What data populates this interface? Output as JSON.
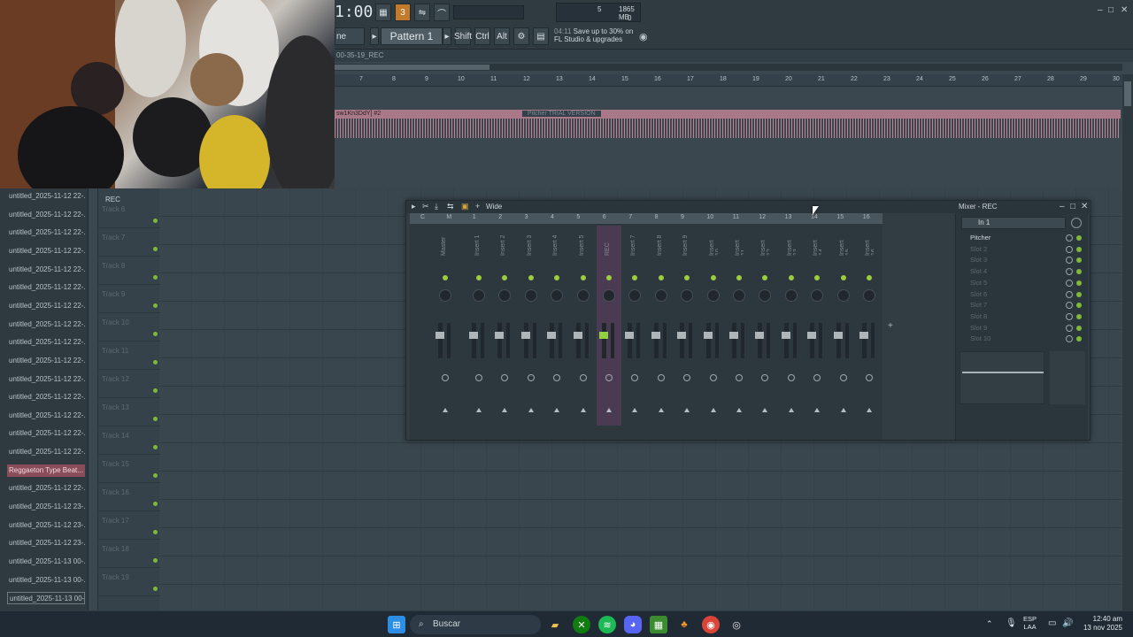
{
  "toolbar": {
    "clock": "1:00",
    "pattern": "Pattern 1",
    "shift": "Shift",
    "ctrl": "Ctrl",
    "alt": "Alt",
    "mode_label": "ne",
    "cpu_value": "5",
    "mem_value": "1865 MB",
    "mem_sub": "0",
    "promo_time": "04:11",
    "promo_text": "Save up to 30% on FL Studio & upgrades"
  },
  "playlist": {
    "title": "00-35-19_REC",
    "ruler": [
      "7",
      "8",
      "9",
      "10",
      "11",
      "12",
      "13",
      "14",
      "15",
      "16",
      "17",
      "18",
      "19",
      "20",
      "21",
      "22",
      "23",
      "24",
      "25",
      "26",
      "27",
      "28",
      "29",
      "30"
    ],
    "clip_label": "sw1Kn3DdY] #2",
    "pitcher_label": "Pitcher TRIAL VERSION",
    "rec_track_label": "REC"
  },
  "browser": {
    "items": [
      {
        "label": "untitled_2025-11-12 22-..."
      },
      {
        "label": "untitled_2025-11-12 22-..."
      },
      {
        "label": "untitled_2025-11-12 22-..."
      },
      {
        "label": "untitled_2025-11-12 22-..."
      },
      {
        "label": "untitled_2025-11-12 22-..."
      },
      {
        "label": "untitled_2025-11-12 22-..."
      },
      {
        "label": "untitled_2025-11-12 22-..."
      },
      {
        "label": "untitled_2025-11-12 22-..."
      },
      {
        "label": "untitled_2025-11-12 22-..."
      },
      {
        "label": "untitled_2025-11-12 22-..."
      },
      {
        "label": "untitled_2025-11-12 22-..."
      },
      {
        "label": "untitled_2025-11-12 22-..."
      },
      {
        "label": "untitled_2025-11-12 22-..."
      },
      {
        "label": "untitled_2025-11-12 22-..."
      },
      {
        "label": "untitled_2025-11-12 22-..."
      },
      {
        "label": "Reggaeton Type Beat..."
      },
      {
        "label": "untitled_2025-11-12 22-..."
      },
      {
        "label": "untitled_2025-11-12 23-..."
      },
      {
        "label": "untitled_2025-11-12 23-..."
      },
      {
        "label": "untitled_2025-11-12 23-..."
      },
      {
        "label": "untitled_2025-11-13 00-..."
      },
      {
        "label": "untitled_2025-11-13 00-..."
      },
      {
        "label": "untitled_2025-11-13 00-..."
      }
    ]
  },
  "tracks": [
    "Track 6",
    "Track 7",
    "Track 8",
    "Track 9",
    "Track 10",
    "Track 11",
    "Track 12",
    "Track 13",
    "Track 14",
    "Track 15",
    "Track 16",
    "Track 17",
    "Track 18",
    "Track 19"
  ],
  "mixer": {
    "title": "Mixer - REC",
    "view": "Wide",
    "numbers": [
      "C",
      "M",
      "1",
      "2",
      "3",
      "4",
      "5",
      "6",
      "7",
      "8",
      "9",
      "10",
      "11",
      "12",
      "13",
      "14",
      "15",
      "16"
    ],
    "strips": [
      "Master",
      "Insert 1",
      "Insert 2",
      "Insert 3",
      "Insert 4",
      "Insert 5",
      "REC",
      "Insert 7",
      "Insert 8",
      "Insert 9",
      "Insert 10",
      "Insert 11",
      "Insert 12",
      "Insert 13",
      "Insert 14",
      "Insert 15",
      "Insert 16"
    ],
    "input": "In 1",
    "slots": [
      "Pitcher",
      "Slot 2",
      "Slot 3",
      "Slot 4",
      "Slot 5",
      "Slot 6",
      "Slot 7",
      "Slot 8",
      "Slot 9",
      "Slot 10"
    ]
  },
  "taskbar": {
    "search_placeholder": "Buscar",
    "lang": "ESP",
    "lang_sub": "LAA",
    "time": "12:40 am",
    "date": "13 nov 2025"
  }
}
